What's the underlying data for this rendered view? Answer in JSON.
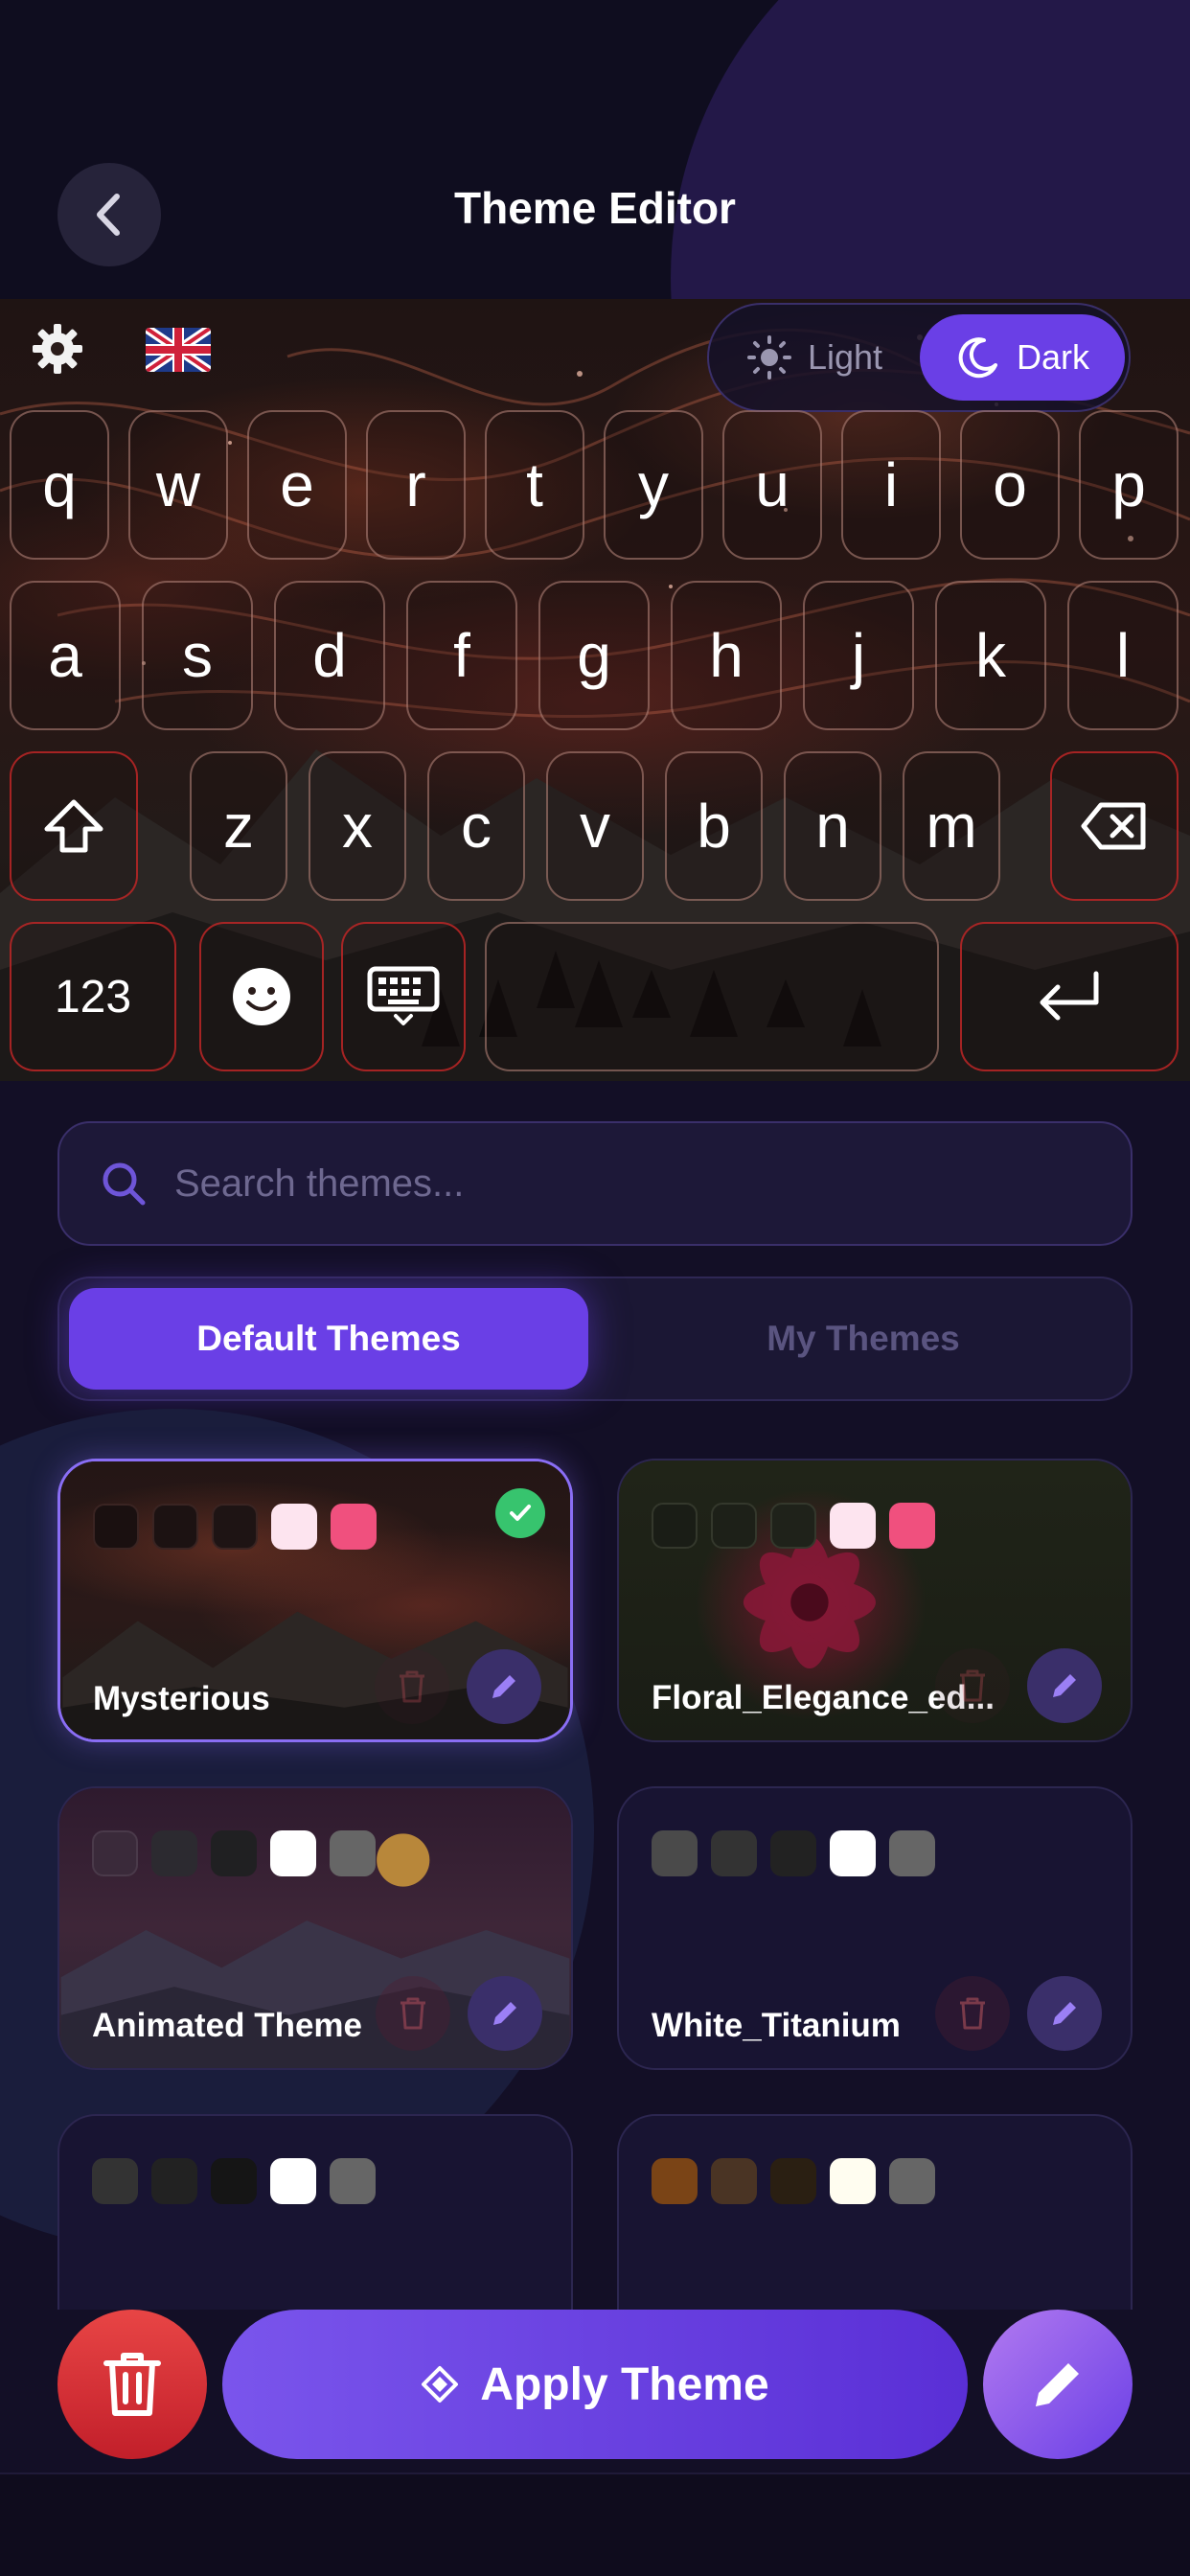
{
  "header": {
    "title": "Theme Editor"
  },
  "keyboard": {
    "mode_light": "Light",
    "mode_dark": "Dark",
    "active_mode": "Dark",
    "row1": [
      "q",
      "w",
      "e",
      "r",
      "t",
      "y",
      "u",
      "i",
      "o",
      "p"
    ],
    "row2": [
      "a",
      "s",
      "d",
      "f",
      "g",
      "h",
      "j",
      "k",
      "l"
    ],
    "row3": [
      "z",
      "x",
      "c",
      "v",
      "b",
      "n",
      "m"
    ],
    "numbers_key": "123"
  },
  "search": {
    "placeholder": "Search themes..."
  },
  "tabs": {
    "default": "Default Themes",
    "mine": "My Themes",
    "active": "Default Themes"
  },
  "themes": [
    {
      "name": "Mysterious",
      "selected": true,
      "swatches": [
        "#1a1010",
        "#1c1212",
        "#1e1414",
        "#fde4ef",
        "#f0507e"
      ]
    },
    {
      "name": "Floral_Elegance_ed...",
      "selected": false,
      "swatches": [
        "#1a1d16",
        "#1d2018",
        "#1f221a",
        "#fde4ef",
        "#f0507e"
      ]
    },
    {
      "name": "Animated Theme",
      "selected": false,
      "swatches": [
        "#3a2a3a",
        "#2c2a30",
        "#202022",
        "#ffffff",
        "#666666"
      ]
    },
    {
      "name": "White_Titanium",
      "selected": false,
      "swatches": [
        "#4a4a4a",
        "#333333",
        "#222222",
        "#ffffff",
        "#666666"
      ]
    },
    {
      "name": "",
      "selected": false,
      "swatches": [
        "#333333",
        "#222222",
        "#151515",
        "#ffffff",
        "#666666"
      ]
    },
    {
      "name": "",
      "selected": false,
      "swatches": [
        "#7a4416",
        "#4a3424",
        "#2a1f12",
        "#fffdf0",
        "#666666"
      ]
    }
  ],
  "actions": {
    "apply_label": "Apply Theme"
  },
  "colors": {
    "accent": "#6a3fe6",
    "background": "#130f26",
    "success": "#37c46e",
    "danger": "#e03a3a"
  }
}
